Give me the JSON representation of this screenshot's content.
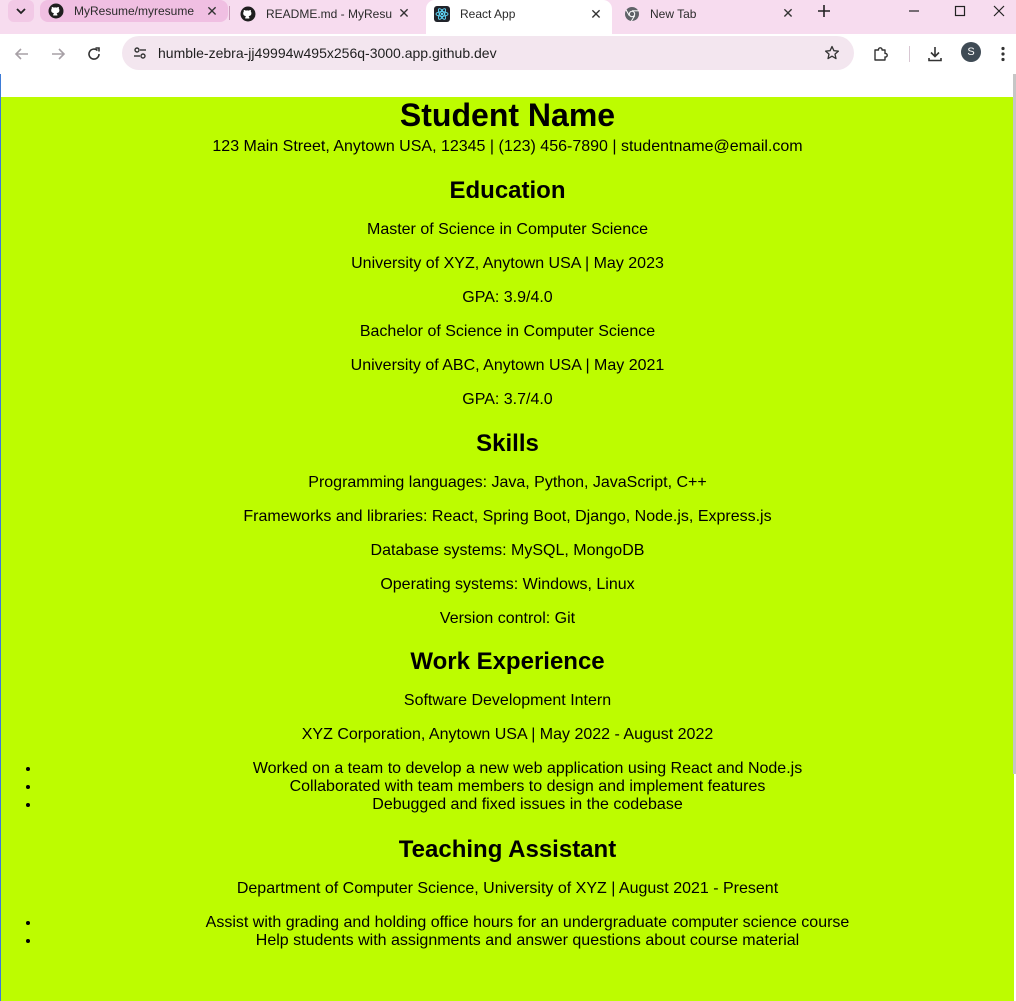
{
  "browser": {
    "tabs": [
      {
        "title": "MyResume/myresume",
        "icon": "github-icon"
      },
      {
        "title": "README.md - MyResu",
        "icon": "github-icon"
      },
      {
        "title": "React App",
        "icon": "react-icon",
        "active": true
      },
      {
        "title": "New Tab",
        "icon": "chrome-icon"
      }
    ],
    "url": "humble-zebra-jj49994w495x256q-3000.app.github.dev",
    "profile_initial": "S"
  },
  "resume": {
    "name": "Student Name",
    "contact": "123 Main Street, Anytown USA, 12345 | (123) 456-7890 | studentname@email.com",
    "education": {
      "heading": "Education",
      "lines": [
        "Master of Science in Computer Science",
        "University of XYZ, Anytown USA | May 2023",
        "GPA: 3.9/4.0",
        "Bachelor of Science in Computer Science",
        "University of ABC, Anytown USA | May 2021",
        "GPA: 3.7/4.0"
      ]
    },
    "skills": {
      "heading": "Skills",
      "lines": [
        "Programming languages: Java, Python, JavaScript, C++",
        "Frameworks and libraries: React, Spring Boot, Django, Node.js, Express.js",
        "Database systems: MySQL, MongoDB",
        "Operating systems: Windows, Linux",
        "Version control: Git"
      ]
    },
    "work": {
      "heading": "Work Experience",
      "role": "Software Development Intern",
      "company": "XYZ Corporation, Anytown USA | May 2022 - August 2022",
      "bullets": [
        "Worked on a team to develop a new web application using React and Node.js",
        "Collaborated with team members to design and implement features",
        "Debugged and fixed issues in the codebase"
      ]
    },
    "ta": {
      "heading": "Teaching Assistant",
      "company": "Department of Computer Science, University of XYZ | August 2021 - Present",
      "bullets": [
        "Assist with grading and holding office hours for an undergraduate computer science course",
        "Help students with assignments and answer questions about course material"
      ]
    }
  },
  "colors": {
    "page_background": "#bdfc00",
    "tabstrip": "#f7dcef",
    "omnibox": "#f3e6ef"
  }
}
